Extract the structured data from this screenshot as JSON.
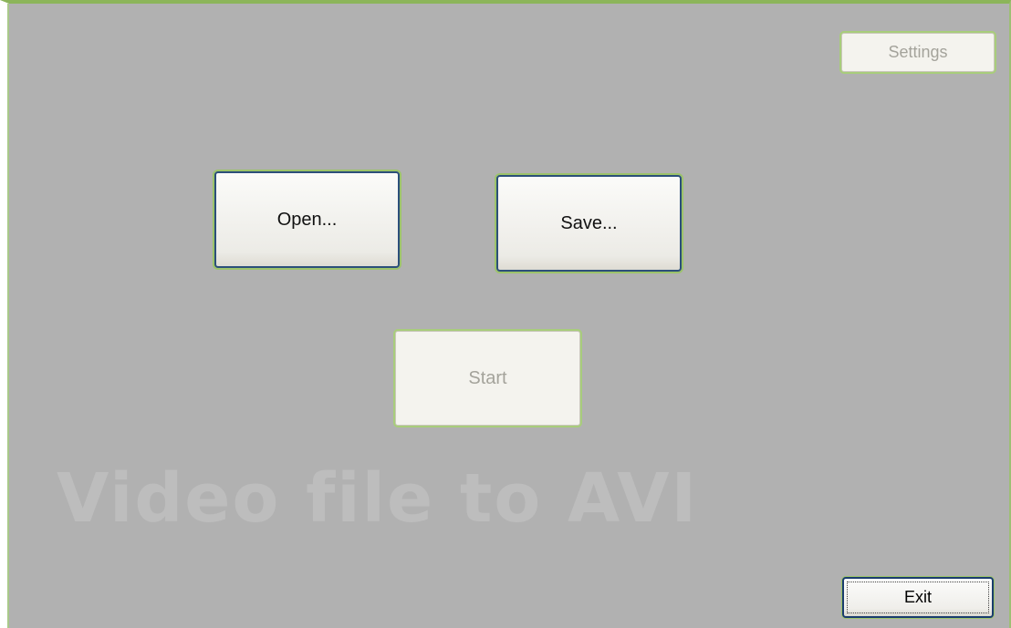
{
  "buttons": {
    "open_label": "Open...",
    "save_label": "Save...",
    "start_label": "Start",
    "settings_label": "Settings",
    "exit_label": "Exit"
  },
  "watermark": "Video file to AVI",
  "colors": {
    "background": "#b1b1b1",
    "accent_border": "#8cb55a",
    "button_border": "#2c4f7a",
    "disabled_text": "#a4a39b",
    "watermark_text": "#bdbdbd"
  },
  "state": {
    "start_enabled": false,
    "settings_enabled": false,
    "focused_button": "Exit"
  }
}
